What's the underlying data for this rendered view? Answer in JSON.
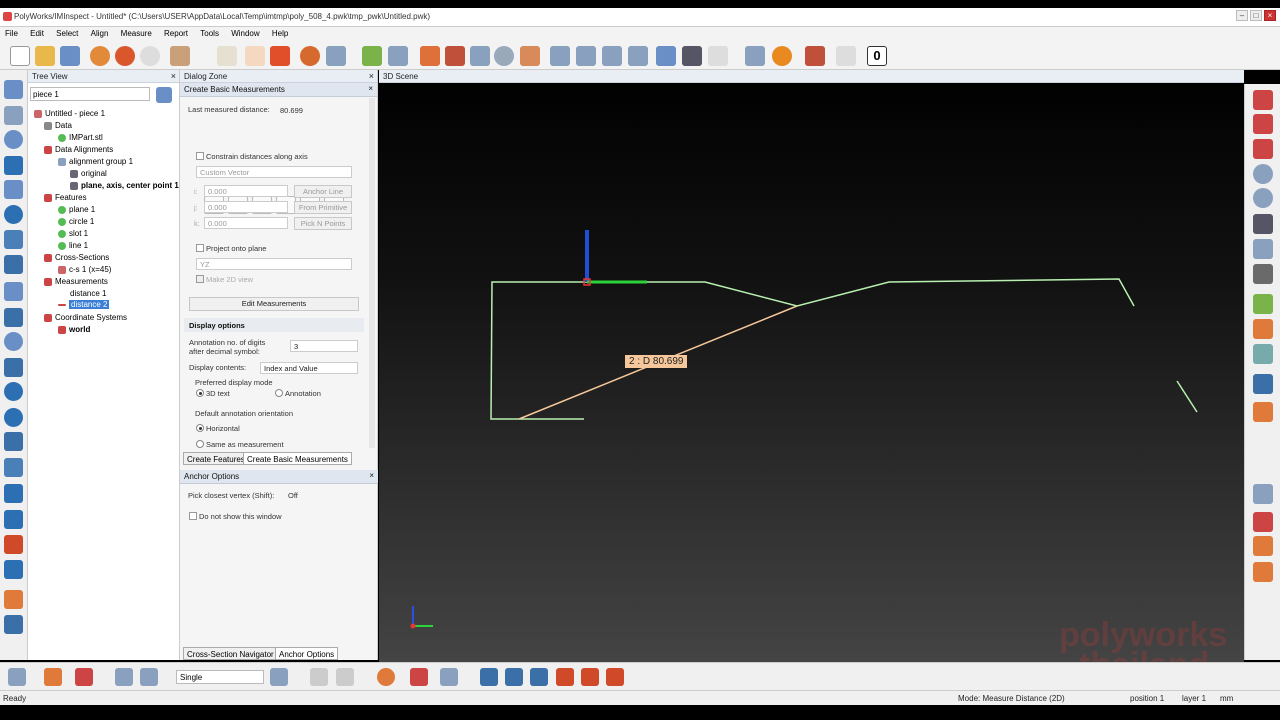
{
  "window": {
    "title": "PolyWorks/IMInspect - Untitled* (C:\\Users\\USER\\AppData\\Local\\Temp\\imtmp\\poly_508_4.pwk\\tmp_pwk\\Untitled.pwk)"
  },
  "menu": [
    "File",
    "Edit",
    "Select",
    "Align",
    "Measure",
    "Report",
    "Tools",
    "Window",
    "Help"
  ],
  "toolbar": {
    "counter": "0"
  },
  "tree_view": {
    "title": "Tree View",
    "search_value": "piece 1",
    "items": [
      {
        "label": "Untitled - piece 1",
        "bold": false
      },
      {
        "label": "Data",
        "bold": false
      },
      {
        "label": "IMPart.stl",
        "bold": false
      },
      {
        "label": "Data Alignments",
        "bold": false
      },
      {
        "label": "alignment group 1",
        "bold": false
      },
      {
        "label": "original",
        "bold": false
      },
      {
        "label": "plane, axis, center point 1",
        "bold": true
      },
      {
        "label": "Features",
        "bold": false
      },
      {
        "label": "plane 1",
        "bold": false
      },
      {
        "label": "circle 1",
        "bold": false
      },
      {
        "label": "slot 1",
        "bold": false
      },
      {
        "label": "line 1",
        "bold": false
      },
      {
        "label": "Cross-Sections",
        "bold": false
      },
      {
        "label": "c-s 1 (x=45)",
        "bold": false
      },
      {
        "label": "Measurements",
        "bold": false
      },
      {
        "label": "distance 1",
        "bold": false
      },
      {
        "label": "distance 2",
        "bold": false,
        "selected": true
      },
      {
        "label": "Coordinate Systems",
        "bold": false
      },
      {
        "label": "world",
        "bold": true
      }
    ]
  },
  "dialog_zone": {
    "title": "Dialog Zone",
    "subtitle": "Create Basic Measurements",
    "last_measured_label": "Last measured distance:",
    "last_measured_value": "80.699",
    "constrain_label": "Constrain distances along axis",
    "vector_select": "Custom Vector",
    "i_label": "i:",
    "i_value": "0.000",
    "j_label": "j:",
    "j_value": "0.000",
    "k_label": "k:",
    "k_value": "0.000",
    "anchor_line": "Anchor Line",
    "from_primitive": "From Primitive",
    "pick_n_points": "Pick N Points",
    "project_label": "Project onto plane",
    "plane_select": "YZ",
    "make2d_label": "Make 2D view",
    "edit_measurements": "Edit Measurements",
    "display_options": "Display options",
    "annotation_digits_label": "Annotation no. of digits after decimal symbol:",
    "annotation_digits_value": "3",
    "display_contents_label": "Display contents:",
    "display_contents_value": "Index and Value",
    "preferred_mode_label": "Preferred display mode",
    "mode_3d": "3D text",
    "mode_annotation": "Annotation",
    "orientation_label": "Default annotation orientation",
    "orient_horizontal": "Horizontal",
    "orient_same": "Same as measurement",
    "tab_create_features": "Create Features",
    "tab_create_basic": "Create Basic Measurements"
  },
  "anchor_options": {
    "title": "Anchor Options",
    "pick_label": "Pick closest vertex (Shift):",
    "pick_value": "Off",
    "dont_show": "Do not show this window",
    "tab_cross_section": "Cross-Section Navigator",
    "tab_anchor": "Anchor Options"
  },
  "scene": {
    "title": "3D Scene",
    "measurement_label": "2 : D 80.699",
    "profile_color": "#b8f0b0",
    "measure_color": "#f5c79a"
  },
  "bottom": {
    "mode_select": "Single"
  },
  "status": {
    "ready": "Ready",
    "mode": "Mode: Measure Distance (2D)",
    "position": "position 1",
    "layer": "layer 1",
    "unit": "mm"
  },
  "watermark": {
    "line1": "polyworks",
    "line2": "thailand"
  }
}
